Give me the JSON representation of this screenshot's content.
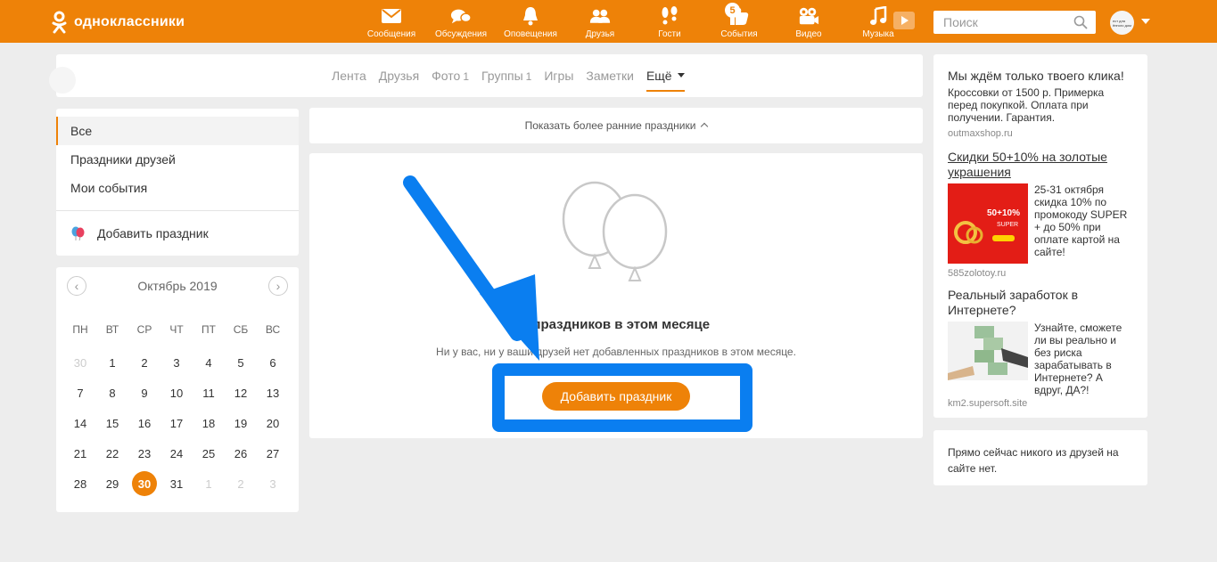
{
  "header": {
    "logo_text": "одноклассники",
    "nav": [
      {
        "label": "Сообщения",
        "icon": "envelope-icon"
      },
      {
        "label": "Обсуждения",
        "icon": "chat-bubbles-icon"
      },
      {
        "label": "Оповещения",
        "icon": "bell-icon"
      },
      {
        "label": "Друзья",
        "icon": "friends-icon"
      },
      {
        "label": "Гости",
        "icon": "footprints-icon"
      },
      {
        "label": "События",
        "icon": "thumbs-up-icon",
        "badge": "5"
      },
      {
        "label": "Видео",
        "icon": "video-camera-icon"
      },
      {
        "label": "Музыка",
        "icon": "music-note-icon"
      }
    ],
    "search_placeholder": "Поиск",
    "avatar_text": "ест для ённого дом"
  },
  "tabs": [
    {
      "label": "Лента",
      "count": ""
    },
    {
      "label": "Друзья",
      "count": ""
    },
    {
      "label": "Фото",
      "count": "1"
    },
    {
      "label": "Группы",
      "count": "1"
    },
    {
      "label": "Игры",
      "count": ""
    },
    {
      "label": "Заметки",
      "count": ""
    },
    {
      "label": "Ещё",
      "count": ""
    }
  ],
  "left_menu": {
    "items": [
      "Все",
      "Праздники друзей",
      "Мои события"
    ],
    "add_label": "Добавить праздник"
  },
  "calendar": {
    "month": "Октябрь 2019",
    "weekdays": [
      "ПН",
      "ВТ",
      "СР",
      "ЧТ",
      "ПТ",
      "СБ",
      "ВС"
    ],
    "days": [
      [
        "30",
        "1",
        "2",
        "3",
        "4",
        "5",
        "6"
      ],
      [
        "7",
        "8",
        "9",
        "10",
        "11",
        "12",
        "13"
      ],
      [
        "14",
        "15",
        "16",
        "17",
        "18",
        "19",
        "20"
      ],
      [
        "21",
        "22",
        "23",
        "24",
        "25",
        "26",
        "27"
      ],
      [
        "28",
        "29",
        "30",
        "31",
        "1",
        "2",
        "3"
      ]
    ],
    "today": "30"
  },
  "main": {
    "show_earlier": "Показать более ранние праздники",
    "empty_title": "т праздников в этом месяце",
    "empty_sub": "Ни у вас, ни у ваши друзей нет добавленных праздников в этом месяце.",
    "add_button": "Добавить праздник"
  },
  "colors": {
    "brand": "#ee8208",
    "highlight": "#0a7ef0"
  },
  "ads": {
    "ad1": {
      "title": "Мы ждём только твоего клика!",
      "text": "Кроссовки от 1500 р. Примерка перед покупкой. Оплата при получении. Гарантия.",
      "domain": "outmaxshop.ru"
    },
    "ad2": {
      "title": "Скидки 50+10% на золотые украшения",
      "text": "25-31 октября скидка 10% по промокоду SUPER + до 50% при оплате картой на сайте!",
      "domain": "585zolotoy.ru",
      "img_text": "50+10%",
      "img_sub": "SUPER"
    },
    "ad3": {
      "title": "Реальный заработок в Интернете?",
      "text": "Узнайте, сможете ли вы реально и без риска зарабатывать в Интернете? А вдруг, ДА?!",
      "domain": "km2.supersoft.site"
    }
  },
  "friends_online": "Прямо сейчас никого из друзей на сайте нет."
}
